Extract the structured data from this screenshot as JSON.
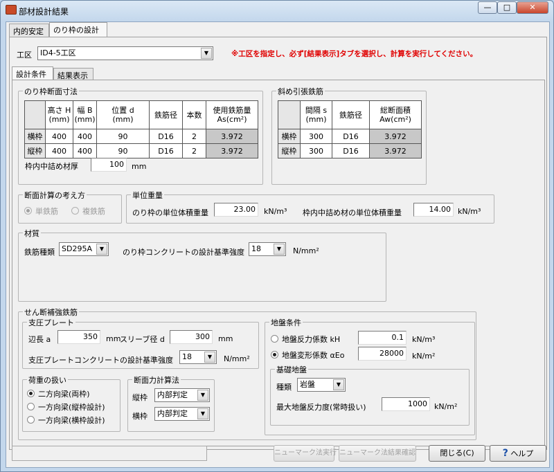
{
  "window": {
    "title": "部材設計結果",
    "min": "—",
    "max": "□",
    "close": "✕"
  },
  "tabs_top": [
    "内的安定",
    "のり枠の設計"
  ],
  "kouku": {
    "label": "工区",
    "value": "ID4-5工区",
    "warning": "※工区を指定し、必ず[結果表示]タブを選択し、計算を実行してください。"
  },
  "tabs_inner": [
    "設計条件",
    "結果表示"
  ],
  "frame": {
    "title": "のり枠断面寸法",
    "headers": [
      "高さ H\n(mm)",
      "幅 B\n(mm)",
      "位置 d\n(mm)",
      "鉄筋径",
      "本数",
      "使用鉄筋量\nAs(cm²)"
    ],
    "rows": [
      {
        "name": "横枠",
        "cells": [
          "400",
          "400",
          "90",
          "D16",
          "2",
          "3.972"
        ]
      },
      {
        "name": "縦枠",
        "cells": [
          "400",
          "400",
          "90",
          "D16",
          "2",
          "3.972"
        ]
      }
    ],
    "infill_label": "枠内中詰め材厚",
    "infill_value": "100",
    "infill_unit": "mm"
  },
  "diag": {
    "title": "斜め引張鉄筋",
    "headers": [
      "間隔 s\n(mm)",
      "鉄筋径",
      "総断面積\nAw(cm²)"
    ],
    "rows": [
      {
        "name": "横枠",
        "cells": [
          "300",
          "D16",
          "3.972"
        ]
      },
      {
        "name": "縦枠",
        "cells": [
          "300",
          "D16",
          "3.972"
        ]
      }
    ]
  },
  "section_calc": {
    "title": "断面計算の考え方",
    "opt1": "単鉄筋",
    "opt2": "複鉄筋"
  },
  "unit_weight": {
    "title": "単位重量",
    "l1": "のり枠の単位体積重量",
    "v1": "23.00",
    "u1": "kN/m³",
    "l2": "枠内中詰め材の単位体積重量",
    "v2": "14.00",
    "u2": "kN/m³"
  },
  "material": {
    "title": "材質",
    "rebar_label": "鉄筋種類",
    "rebar_value": "SD295A",
    "conc_label": "のり枠コンクリートの設計基準強度",
    "conc_value": "18",
    "conc_unit": "N/mm²"
  },
  "shear": {
    "title": "せん断補強鉄筋",
    "plate": {
      "title": "支圧プレート",
      "side_label": "辺長 a",
      "side_value": "350",
      "side_unit": "mm",
      "sleeve_label": "スリーブ径 d",
      "sleeve_value": "300",
      "sleeve_unit": "mm",
      "conc_label": "支圧プレートコンクリートの設計基準強度",
      "conc_value": "18",
      "conc_unit": "N/mm²"
    },
    "load": {
      "title": "荷重の扱い",
      "o1": "二方向梁(両枠)",
      "o2": "一方向梁(縦枠設計)",
      "o3": "一方向梁(横枠設計)"
    },
    "method": {
      "title": "断面力計算法",
      "l1": "縦枠",
      "v1": "内部判定",
      "l2": "横枠",
      "v2": "内部判定"
    },
    "ground": {
      "title": "地盤条件",
      "o1": "地盤反力係数 kH",
      "v1": "0.1",
      "u1": "kN/m³",
      "o2": "地盤変形係数 αEo",
      "v2": "28000",
      "u2": "kN/m²",
      "base": {
        "title": "基礎地盤",
        "kind_label": "種類",
        "kind_value": "岩盤",
        "max_label": "最大地盤反力度(常時扱い)",
        "max_value": "1000",
        "max_unit": "kN/m²"
      }
    }
  },
  "footer": {
    "b1": "ニューマーク法実行",
    "b2": "ニューマーク法結果確認",
    "b3": "閉じる(C)",
    "b4": "ヘルプ"
  },
  "colors": {
    "warning": "#e00000",
    "gray_cell": "#c8c8c8",
    "help_icon": "#1a4fa8"
  }
}
